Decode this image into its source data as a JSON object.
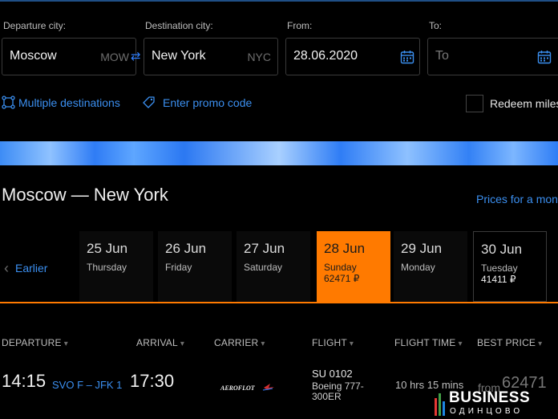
{
  "search": {
    "departure": {
      "label": "Departure city:",
      "city": "Moscow",
      "code": "MOW"
    },
    "destination": {
      "label": "Destination city:",
      "city": "New York",
      "code": "NYC"
    },
    "from": {
      "label": "From:",
      "value": "28.06.2020"
    },
    "to": {
      "label": "To:",
      "value": "To"
    },
    "multiple_destinations": "Multiple destinations",
    "promo": "Enter promo code",
    "redeem": "Redeem miles"
  },
  "route": {
    "title": "Moscow — New York",
    "prices_link": "Prices for a month"
  },
  "calendar": {
    "earlier": "Earlier",
    "days": [
      {
        "date": "25 Jun",
        "weekday": "Thursday",
        "price": ""
      },
      {
        "date": "26 Jun",
        "weekday": "Friday",
        "price": ""
      },
      {
        "date": "27 Jun",
        "weekday": "Saturday",
        "price": ""
      },
      {
        "date": "28 Jun",
        "weekday": "Sunday",
        "price": "62471 ₽"
      },
      {
        "date": "29 Jun",
        "weekday": "Monday",
        "price": ""
      },
      {
        "date": "30 Jun",
        "weekday": "Tuesday",
        "price": "41411 ₽"
      }
    ],
    "selected_index": 3
  },
  "table": {
    "headers": {
      "departure": "DEPARTURE",
      "arrival": "ARRIVAL",
      "carrier": "CARRIER",
      "flight": "FLIGHT",
      "flight_time": "FLIGHT TIME",
      "best_price": "BEST PRICE"
    },
    "rows": [
      {
        "dep_time": "14:15",
        "airports": "SVO F – JFK 1",
        "arr_time": "17:30",
        "carrier": "AEROFLOT",
        "flight": "SU 0102",
        "aircraft": "Boeing 777-300ER",
        "flight_time": "10 hrs 15 mins",
        "from_label": "from",
        "price": "62471"
      }
    ]
  },
  "watermark": {
    "title": "BUSINESS",
    "subtitle": "ОДИНЦОВО"
  },
  "colors": {
    "accent": "#ff7a00",
    "link": "#3b8ff0",
    "background": "#000000"
  }
}
